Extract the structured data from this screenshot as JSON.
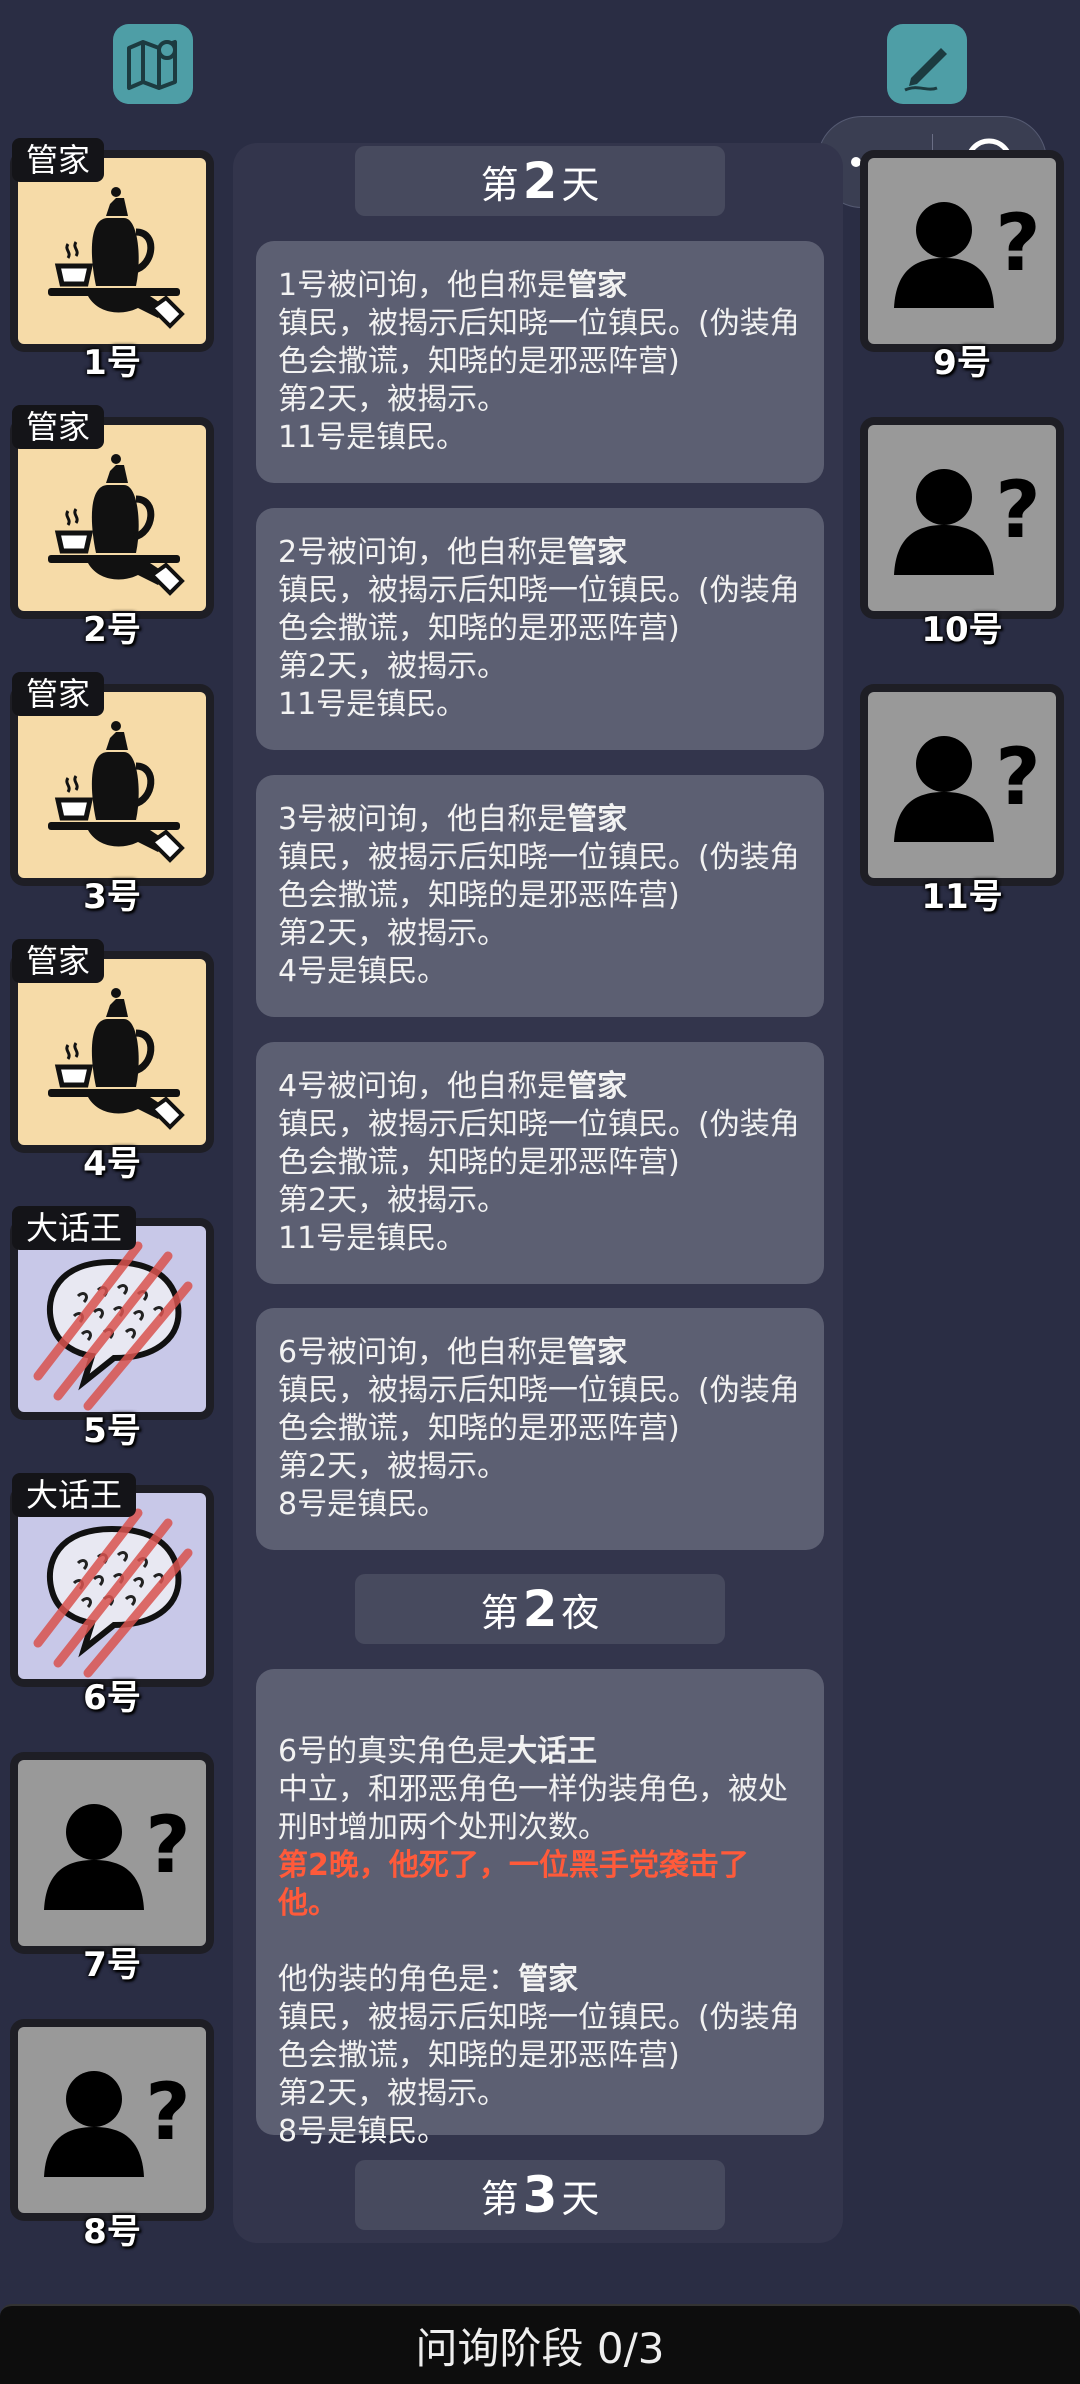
{
  "players_left": [
    {
      "num": "1号",
      "role": "管家",
      "type": "butler"
    },
    {
      "num": "2号",
      "role": "管家",
      "type": "butler"
    },
    {
      "num": "3号",
      "role": "管家",
      "type": "butler"
    },
    {
      "num": "4号",
      "role": "管家",
      "type": "butler"
    },
    {
      "num": "5号",
      "role": "大话王",
      "type": "liar"
    },
    {
      "num": "6号",
      "role": "大话王",
      "type": "liar"
    },
    {
      "num": "7号",
      "role": "",
      "type": "unknown"
    },
    {
      "num": "8号",
      "role": "",
      "type": "unknown"
    }
  ],
  "players_right": [
    {
      "num": "9号",
      "type": "unknown"
    },
    {
      "num": "10号",
      "type": "unknown"
    },
    {
      "num": "11号",
      "type": "unknown"
    }
  ],
  "headers": [
    {
      "prefix": "第",
      "n": "2",
      "suffix": "天"
    },
    {
      "prefix": "第",
      "n": "2",
      "suffix": "夜"
    },
    {
      "prefix": "第",
      "n": "3",
      "suffix": "天"
    }
  ],
  "messages": [
    {
      "intro": "1号被问询，他自称是",
      "role": "管家",
      "desc": "镇民，被揭示后知晓一位镇民。(伪装角色会撒谎，知晓的是邪恶阵营)",
      "line3": "第2天，被揭示。",
      "line4": "11号是镇民。"
    },
    {
      "intro": "2号被问询，他自称是",
      "role": "管家",
      "desc": "镇民，被揭示后知晓一位镇民。(伪装角色会撒谎，知晓的是邪恶阵营)",
      "line3": "第2天，被揭示。",
      "line4": "11号是镇民。"
    },
    {
      "intro": "3号被问询，他自称是",
      "role": "管家",
      "desc": "镇民，被揭示后知晓一位镇民。(伪装角色会撒谎，知晓的是邪恶阵营)",
      "line3": "第2天，被揭示。",
      "line4": "4号是镇民。"
    },
    {
      "intro": "4号被问询，他自称是",
      "role": "管家",
      "desc": "镇民，被揭示后知晓一位镇民。(伪装角色会撒谎，知晓的是邪恶阵营)",
      "line3": "第2天，被揭示。",
      "line4": "11号是镇民。"
    },
    {
      "intro": "6号被问询，他自称是",
      "role": "管家",
      "desc": "镇民，被揭示后知晓一位镇民。(伪装角色会撒谎，知晓的是邪恶阵营)",
      "line3": "第2天，被揭示。",
      "line4": "8号是镇民。"
    }
  ],
  "night_message": {
    "intro": "6号的真实角色是",
    "role": "大话王",
    "desc": "中立，和邪恶角色一样伪装角色，被处刑时增加两个处刑次数。",
    "death": "第2晚，他死了，一位黑手党袭击了他。",
    "disguise_intro": "他伪装的角色是：",
    "disguise_role": "管家",
    "disguise_desc": "镇民，被揭示后知晓一位镇民。(伪装角色会撒谎，知晓的是邪恶阵营)",
    "line3": "第2天，被揭示。",
    "line4": "8号是镇民。"
  },
  "footer": {
    "label": "问询阶段 0/3"
  },
  "icons": {
    "map": "map-icon",
    "edit": "edit-icon",
    "more": "more-icon",
    "close": "target-icon"
  }
}
